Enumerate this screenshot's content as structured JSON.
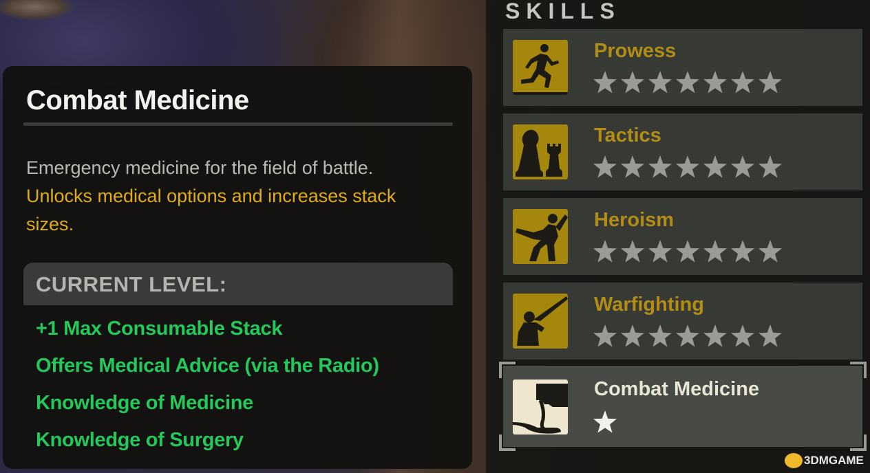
{
  "info": {
    "title": "Combat Medicine",
    "description": "Emergency medicine for the field of battle.",
    "description_highlight": "Unlocks medical options and increases stack sizes.",
    "current_level_label": "CURRENT LEVEL:",
    "effects": [
      "+1 Max Consumable Stack",
      "Offers Medical Advice (via the Radio)",
      "Knowledge of Medicine",
      "Knowledge of Surgery"
    ]
  },
  "skills": {
    "header": "SKILLS",
    "max_stars": 7,
    "items": [
      {
        "name": "Prowess",
        "icon": "runner-icon",
        "stars": 0
      },
      {
        "name": "Tactics",
        "icon": "chess-pieces-icon",
        "stars": 0
      },
      {
        "name": "Heroism",
        "icon": "martial-arts-kick-icon",
        "stars": 0
      },
      {
        "name": "Warfighting",
        "icon": "rifleman-icon",
        "stars": 0
      },
      {
        "name": "Combat Medicine",
        "icon": "medicine-spoon-icon",
        "stars": 1,
        "selected": true
      }
    ]
  },
  "watermark": "3DMGAME",
  "colors": {
    "accent_gold": "#b28d16",
    "highlight_yellow": "#e0ad1a",
    "effect_green": "#24c85b"
  }
}
